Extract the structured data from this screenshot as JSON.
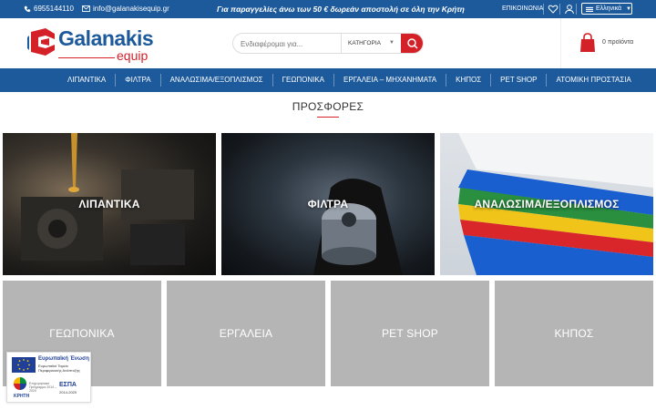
{
  "topbar": {
    "phone": "6955144110",
    "email": "info@galanakisequip.gr",
    "promo": "Για παραγγελίες άνω των 50 € δωρεάν αποστολή σε όλη την Κρήτη",
    "contact_link": "ΕΠΙΚΟΙΝΩΝΙΑ",
    "language": "Ελληνικά"
  },
  "logo": {
    "word": "Galanakis",
    "sub": "equip"
  },
  "search": {
    "placeholder": "Ενδιαφέρομαι για...",
    "category": "ΚΑΤΗΓΟΡΙΑ"
  },
  "cart": {
    "label": "0 προϊόντα"
  },
  "nav": {
    "items": [
      "ΛΙΠΑΝΤΙΚΑ",
      "ΦΙΛΤΡΑ",
      "ΑΝΑΛΩΣΙΜΑ/ΕΞΟΠΛΙΣΜΟΣ",
      "ΓΕΩΠΟΝΙΚΑ",
      "ΕΡΓΑΛΕΙΑ – ΜΗΧΑΝΗΜΑΤΑ",
      "ΚΗΠΟΣ",
      "PET SHOP",
      "ΑΤΟΜΙΚΗ ΠΡΟΣΤΑΣΙΑ"
    ]
  },
  "offers": {
    "title": "ΠΡΟΣΦΟΡΕΣ",
    "tiles": [
      "ΛΙΠΑΝΤΙΚΑ",
      "ΦΙΛΤΡΑ",
      "ΑΝΑΛΩΣΙΜΑ/ΕΞΟΠΛΙΣΜΟΣ",
      "ΓΕΩΠΟΝΙΚΑ",
      "ΕΡΓΑΛΕΙΑ",
      "PET SHOP",
      "ΚΗΠΟΣ"
    ]
  },
  "eu_badge": {
    "title": "Ευρωπαϊκή Ένωση",
    "subtitle": "Ευρωπαϊκό Ταμείο Περιφερειακής Ανάπτυξης",
    "program": "Επιχειρησιακό Πρόγραμμα",
    "region": "ΚΡΗΤΗ",
    "region_years": "2014 – 2020",
    "espa": "ΕΣΠΑ",
    "espa_years": "2014-2020"
  },
  "colors": {
    "brand_blue": "#1d5a9c",
    "brand_red": "#d32127",
    "tile_grey": "#b5b5b5"
  },
  "icons": [
    "phone-icon",
    "mail-icon",
    "heart-icon",
    "user-icon",
    "search-icon",
    "cart-icon",
    "chevron-down-icon"
  ]
}
